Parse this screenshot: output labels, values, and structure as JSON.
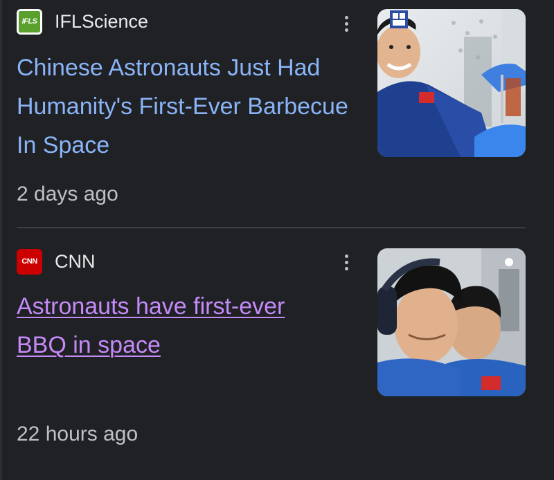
{
  "articles": [
    {
      "source": "IFLScience",
      "favicon_text": "IFLS",
      "headline": "Chinese Astronauts Just Had Humanity's First-Ever Barbecue In Space",
      "timestamp": "2 days ago",
      "link_state": "unvisited",
      "link_color": "#8ab4f8",
      "menu_icon": "more-vert-icon"
    },
    {
      "source": "CNN",
      "favicon_text": "CNN",
      "headline": "Astronauts have first-ever BBQ in space",
      "timestamp": "22 hours ago",
      "link_state": "visited",
      "link_color": "#c58af9",
      "menu_icon": "more-vert-icon"
    }
  ],
  "theme": {
    "background": "#202124",
    "text_secondary": "#bdc1c6",
    "divider": "#5f6368"
  }
}
